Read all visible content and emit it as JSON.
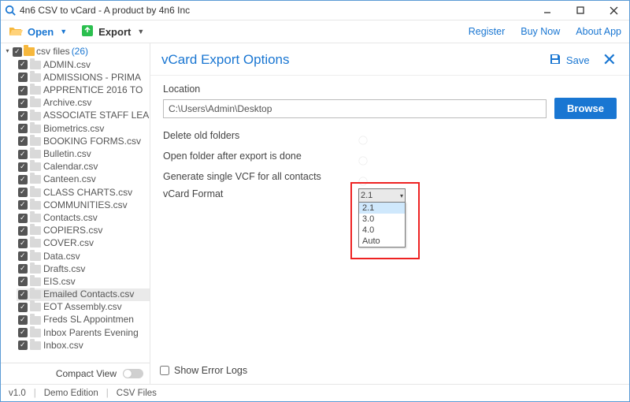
{
  "window_title": "4n6 CSV to vCard - A product by 4n6 Inc",
  "toolbar": {
    "open_label": "Open",
    "export_label": "Export",
    "register_label": "Register",
    "buy_now_label": "Buy Now",
    "about_label": "About App"
  },
  "tree": {
    "root_label": "csv files",
    "root_count": "(26)",
    "items": [
      "ADMIN.csv",
      "ADMISSIONS - PRIMA",
      "APPRENTICE 2016 TO",
      "Archive.csv",
      "ASSOCIATE STAFF LEA",
      "Biometrics.csv",
      "BOOKING FORMS.csv",
      "Bulletin.csv",
      "Calendar.csv",
      "Canteen.csv",
      "CLASS CHARTS.csv",
      "COMMUNITIES.csv",
      "Contacts.csv",
      "COPIERS.csv",
      "COVER.csv",
      "Data.csv",
      "Drafts.csv",
      "EIS.csv",
      "Emailed Contacts.csv",
      "EOT Assembly.csv",
      "Freds  SL Appointmen",
      "Inbox Parents Evening",
      "Inbox.csv"
    ],
    "selected_index": 18
  },
  "compact_label": "Compact View",
  "panel": {
    "title": "vCard Export Options",
    "save_label": "Save",
    "location_label": "Location",
    "location_value": "C:\\Users\\Admin\\Desktop",
    "browse_label": "Browse",
    "opt_delete": "Delete old folders",
    "opt_openfolder": "Open folder after export is done",
    "opt_singlevcf": "Generate single VCF for all contacts",
    "opt_format": "vCard Format",
    "format_selected": "2.1",
    "format_options": [
      "2.1",
      "3.0",
      "4.0",
      "Auto"
    ],
    "errorlogs_label": "Show Error Logs"
  },
  "status": {
    "version": "v1.0",
    "edition": "Demo Edition",
    "files": "CSV Files"
  }
}
